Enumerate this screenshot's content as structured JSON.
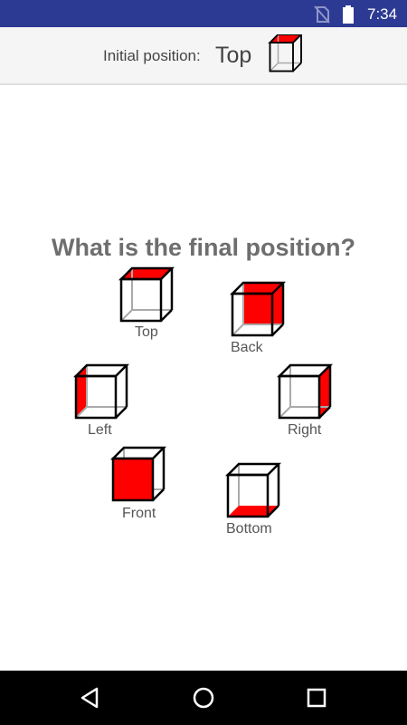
{
  "status_bar": {
    "time": "7:34",
    "icons": [
      "no-sim-icon",
      "battery-icon"
    ]
  },
  "header": {
    "initial_label": "Initial position:",
    "initial_value": "Top",
    "initial_cube_icon": "cube-top-icon"
  },
  "question": "What is the final position?",
  "options": [
    {
      "label": "Top",
      "icon": "cube-top-icon"
    },
    {
      "label": "Back",
      "icon": "cube-back-icon"
    },
    {
      "label": "Left",
      "icon": "cube-left-icon"
    },
    {
      "label": "Right",
      "icon": "cube-right-icon"
    },
    {
      "label": "Front",
      "icon": "cube-front-icon"
    },
    {
      "label": "Bottom",
      "icon": "cube-bottom-icon"
    }
  ],
  "nav_bar": {
    "icons": [
      "back-icon",
      "home-icon",
      "recents-icon"
    ]
  },
  "colors": {
    "status_bar": "#2c3a93",
    "highlight_face": "#ff0000",
    "question_text": "#6e6e6e"
  }
}
